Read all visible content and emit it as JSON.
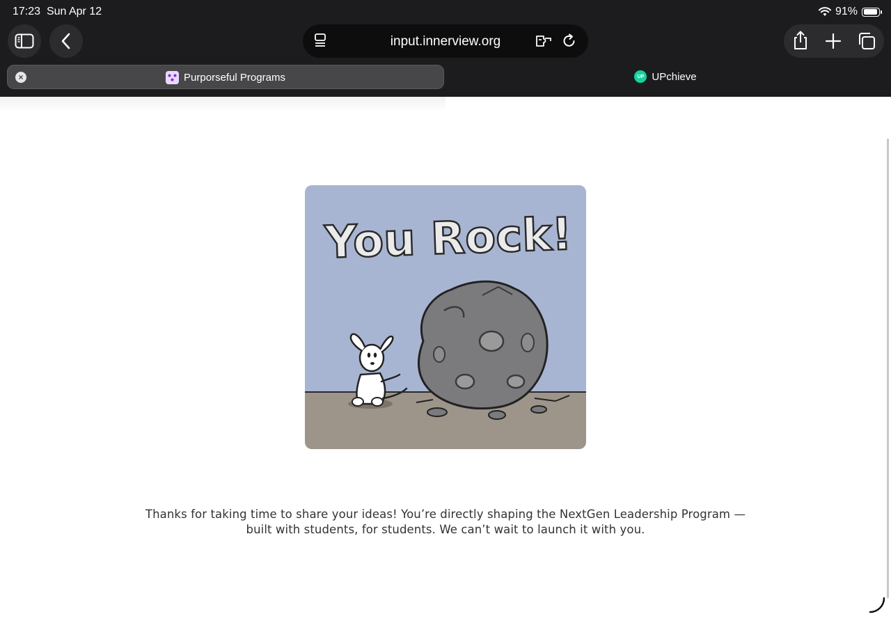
{
  "status_bar": {
    "time": "17:23",
    "date": "Sun Apr 12",
    "battery_text": "91%",
    "battery_level": 0.91
  },
  "toolbar": {
    "url": "input.innerview.org",
    "icons": [
      "sidebar-icon",
      "back-icon",
      "page-menu-icon",
      "extensions-icon",
      "reload-icon",
      "share-icon",
      "new-tab-icon",
      "tabs-overview-icon"
    ]
  },
  "tabs": [
    {
      "label": "Purporseful Programs",
      "active": true
    },
    {
      "label": "UPchieve",
      "active": false
    }
  ],
  "favicon_up_text": "UP",
  "main": {
    "illustration": {
      "headline": "You Rock!",
      "colors": {
        "sky": "#a8b5d2",
        "ground": "#9e958a",
        "rock": "#7b7b7d"
      }
    },
    "thanks_line1": "Thanks for taking  time to share your ideas! You’re directly shaping the NextGen Leadership Program —",
    "thanks_line2": "built with students, for students. We can’t wait to launch it with you."
  }
}
